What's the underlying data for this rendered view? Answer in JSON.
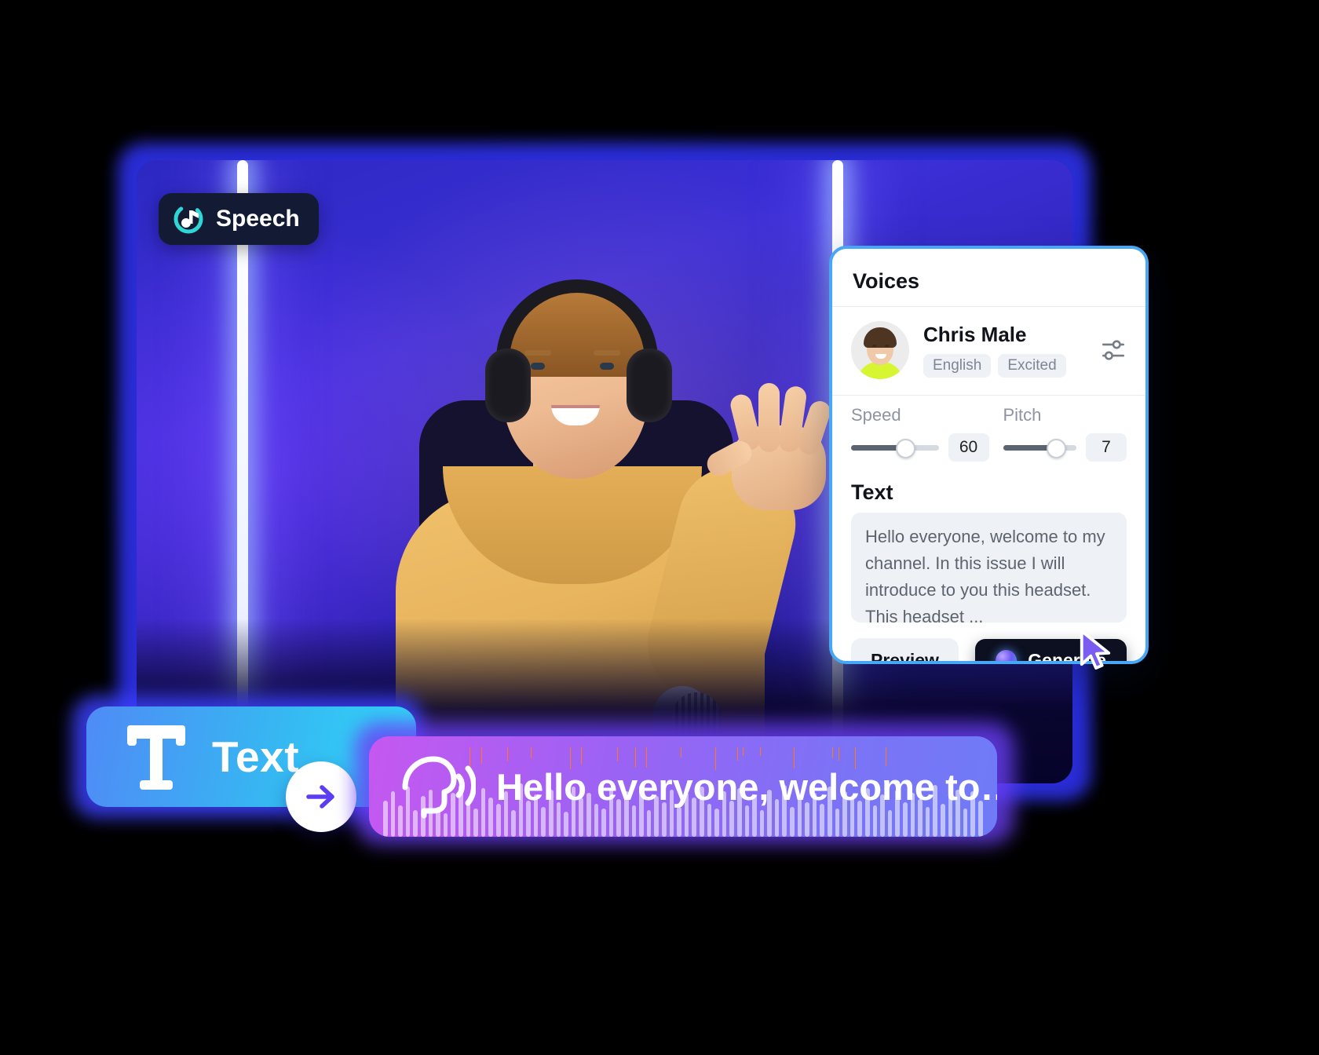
{
  "video": {
    "badge": {
      "label": "Speech",
      "icon": "music-note-circle-icon"
    },
    "caption": "Hello everyone, welcome to my channel."
  },
  "panel": {
    "title": "Voices",
    "voice": {
      "name": "Chris Male",
      "tags": [
        "English",
        "Excited"
      ],
      "avatar_icon": "voice-avatar",
      "settings_icon": "sliders-icon"
    },
    "controls": [
      {
        "label": "Speed",
        "value": "60",
        "percent": 60
      },
      {
        "label": "Pitch",
        "value": "7",
        "percent": 70
      }
    ],
    "text_section": {
      "title": "Text",
      "value": "Hello everyone, welcome to my channel. In this issue I will introduce to you this headset. This headset ..."
    },
    "buttons": {
      "preview": "Preview",
      "generate": "Generate",
      "generate_icon": "ai-orb-icon"
    },
    "cursor_icon": "mouse-pointer-icon"
  },
  "pills": {
    "text": {
      "label": "Text",
      "icon": "text-t-icon"
    },
    "arrow": {
      "icon": "arrow-right-icon"
    },
    "speech": {
      "label": "Hello everyone, welcome to…",
      "icon": "speaking-head-icon"
    }
  },
  "colors": {
    "pill_text_start": "#4f8bf6",
    "pill_text_end": "#2ed8f7",
    "pill_speech_start": "#c558f0",
    "pill_speech_end": "#6f7bf7",
    "panel_border": "#47a6f5",
    "generate_bg": "#0c1020",
    "wave_accent": "#ff7a1a"
  }
}
